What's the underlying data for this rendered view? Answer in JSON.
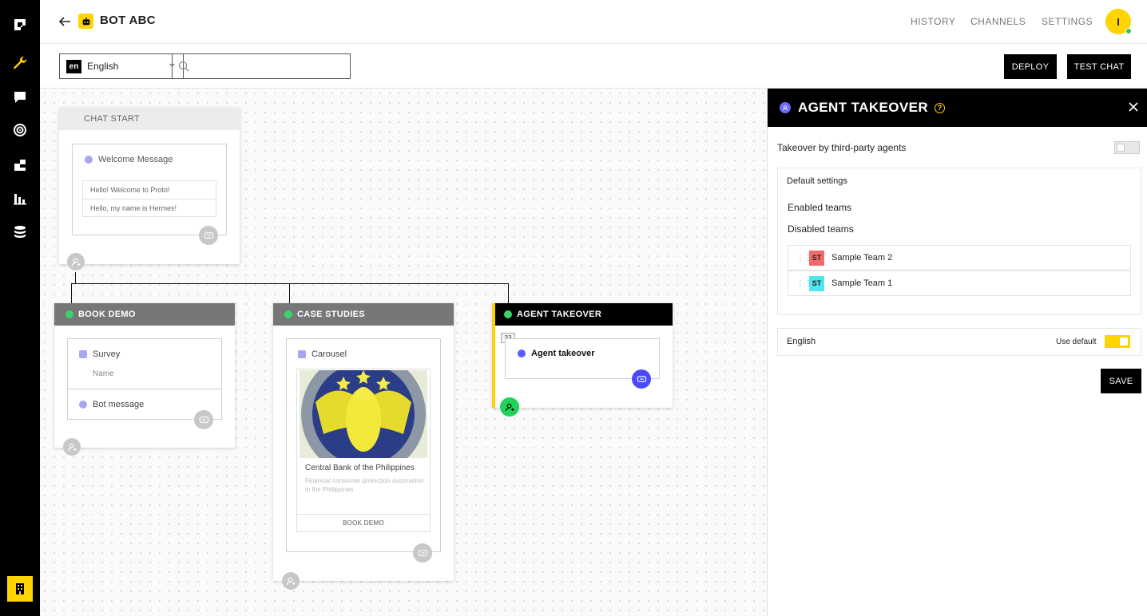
{
  "header": {
    "bot_name": "BOT ABC",
    "nav": [
      "HISTORY",
      "CHANNELS",
      "SETTINGS"
    ],
    "avatar_initial": "I"
  },
  "toolbar": {
    "language_code": "en",
    "language": "English",
    "search_value": "",
    "deploy_label": "DEPLOY",
    "test_chat_label": "TEST CHAT"
  },
  "canvas": {
    "chat_start": {
      "title": "CHAT START",
      "card_label": "Welcome Message",
      "messages": [
        "Hello! Welcome to Proto!",
        "Hello, my name is Hermes!"
      ]
    },
    "book_demo": {
      "title": "BOOK DEMO",
      "survey_label": "Survey",
      "survey_field": "Name",
      "bot_message_label": "Bot message"
    },
    "case_studies": {
      "title": "CASE STUDIES",
      "carousel_label": "Carousel",
      "item_title": "Central Bank of the Philippines",
      "item_subtitle": "Financial consumer protection automation in the Philippines",
      "item_button": "BOOK DEMO"
    },
    "agent_takeover": {
      "title": "AGENT TAKEOVER",
      "counter": "33",
      "card_label": "Agent takeover"
    }
  },
  "panel": {
    "title": "AGENT TAKEOVER",
    "third_party_label": "Takeover by third-party agents",
    "third_party_enabled": false,
    "default_settings_label": "Default settings",
    "enabled_teams_label": "Enabled teams",
    "disabled_teams_label": "Disabled teams",
    "teams": [
      {
        "badge": "ST",
        "name": "Sample Team 2",
        "color": "#ef6b6b"
      },
      {
        "badge": "ST",
        "name": "Sample Team 1",
        "color": "#4fe6f0"
      }
    ],
    "language_label": "English",
    "use_default_label": "Use default",
    "use_default_enabled": true,
    "save_label": "SAVE"
  },
  "colors": {
    "accent": "#ffd400",
    "node_header_gray": "#777777",
    "success": "#31c45a",
    "agent_icon": "#5b5bff"
  }
}
